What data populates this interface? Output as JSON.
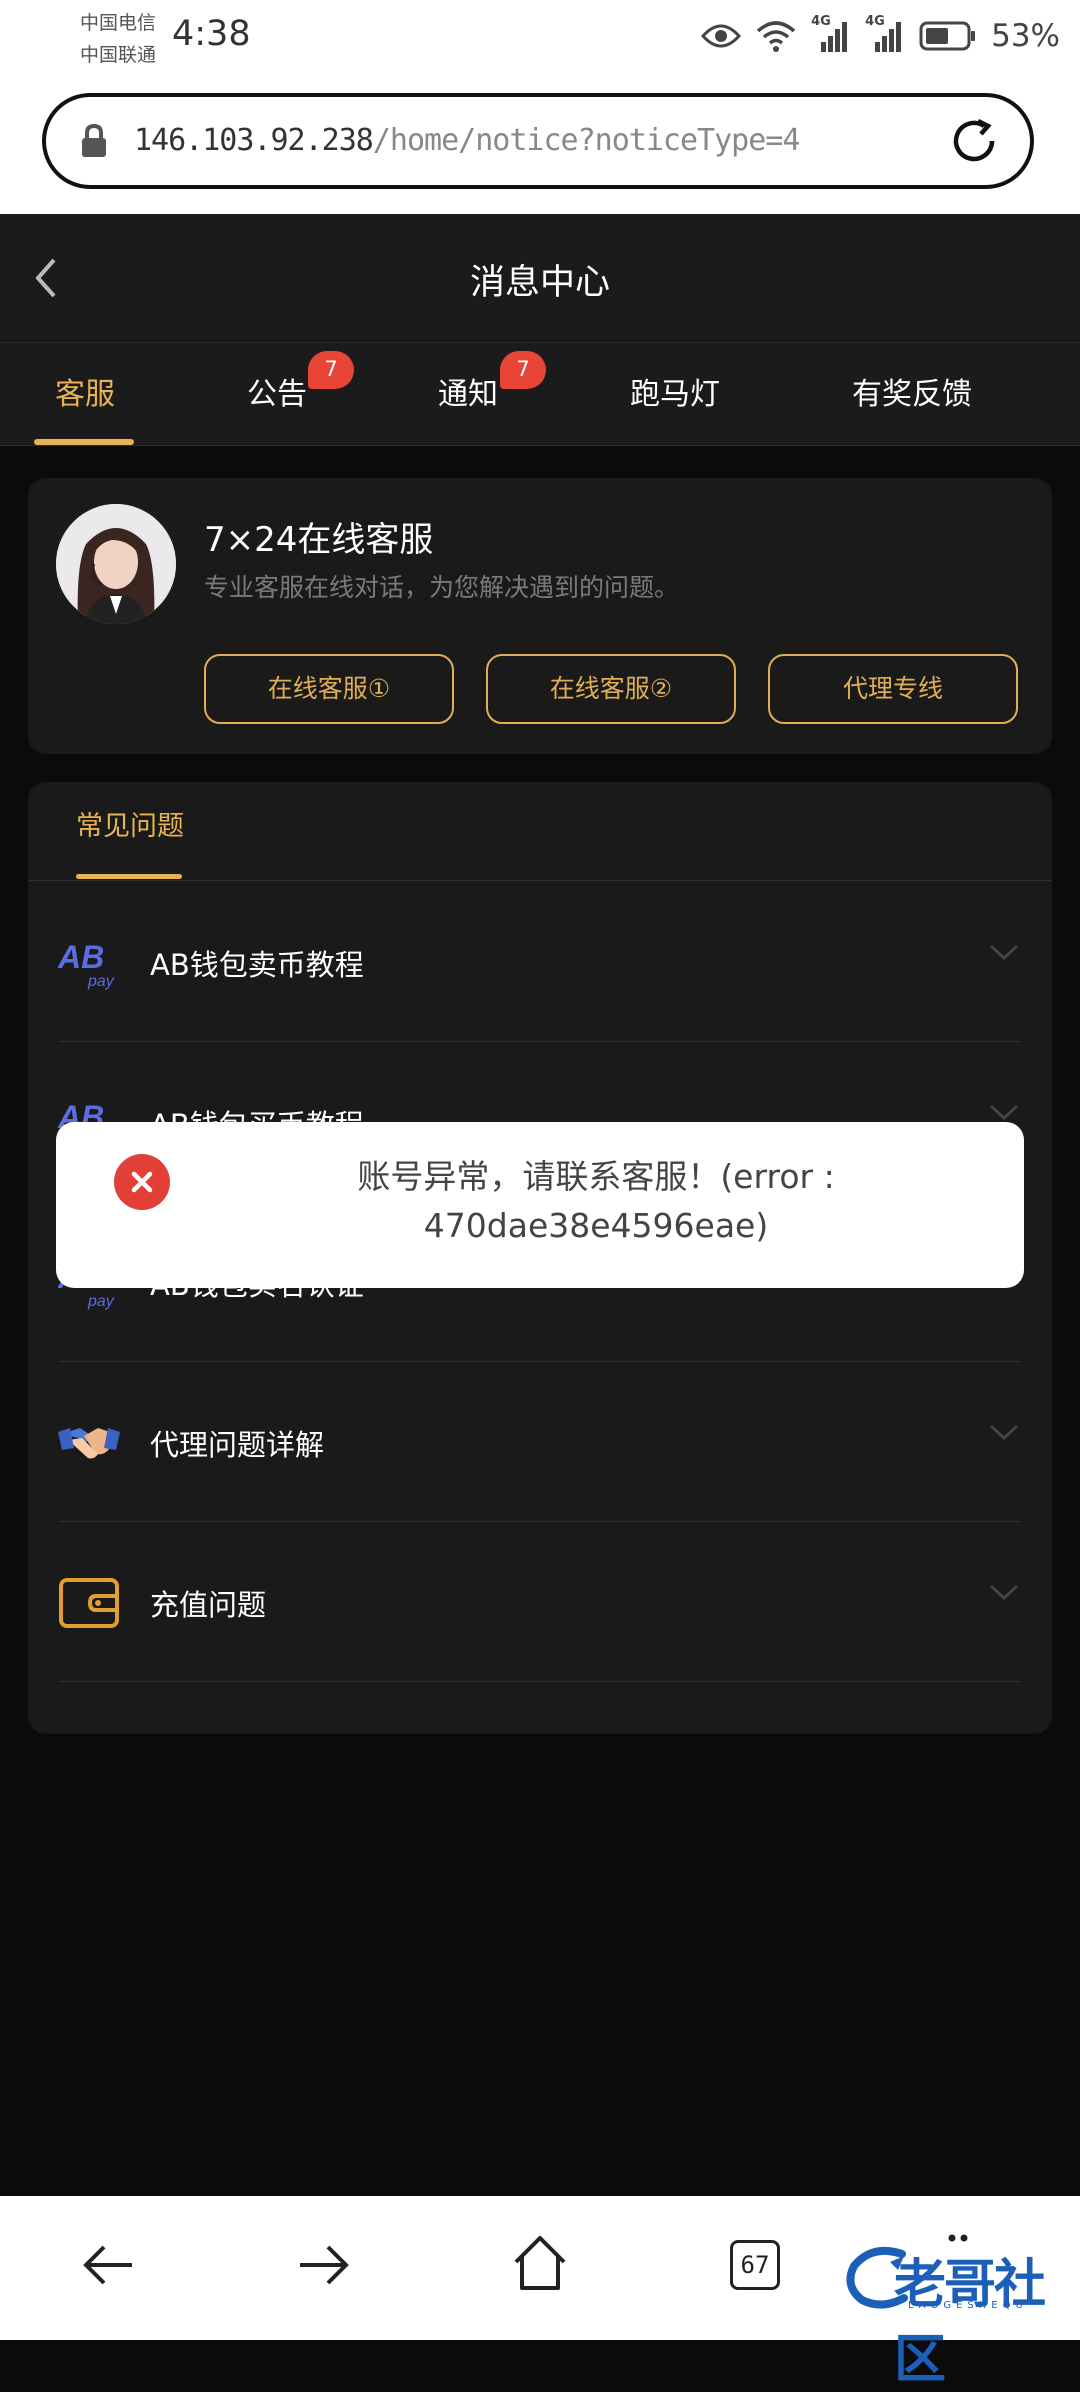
{
  "status_bar": {
    "carrier_1": "中国电信",
    "carrier_2": "中国联通",
    "time": "4:38",
    "battery": "53%",
    "network_1": "4G",
    "network_2": "4G",
    "icons": [
      "eye-icon",
      "wifi-icon",
      "signal-icon",
      "signal-icon",
      "battery-icon"
    ]
  },
  "browser": {
    "url_host": "146.103.92.238",
    "url_path": "/home/notice?noticeType=4"
  },
  "header": {
    "title": "消息中心"
  },
  "tabs": [
    {
      "label": "客服",
      "active": true
    },
    {
      "label": "公告",
      "badge": "7"
    },
    {
      "label": "通知",
      "badge": "7"
    },
    {
      "label": "跑马灯"
    },
    {
      "label": "有奖反馈"
    }
  ],
  "service": {
    "title": "7×24在线客服",
    "description": "专业客服在线对话，为您解决遇到的问题。",
    "buttons": [
      "在线客服①",
      "在线客服②",
      "代理专线"
    ]
  },
  "faq": {
    "tab_label": "常见问题",
    "items": [
      {
        "label": "AB钱包卖币教程",
        "icon": "abpay-icon"
      },
      {
        "label": "AB钱包买币教程",
        "icon": "abpay-icon"
      },
      {
        "label": "AB钱包实名认证",
        "icon": "abpay-icon"
      },
      {
        "label": "代理问题详解",
        "icon": "handshake-icon"
      },
      {
        "label": "充值问题",
        "icon": "wallet-icon"
      }
    ]
  },
  "toast": {
    "line_1": "账号异常，请联系客服！(error :",
    "line_2": "470dae38e4596eae)"
  },
  "bottom_nav": {
    "tab_count": "67",
    "watermark": "老哥社区",
    "watermark_sub": "LAOGESHEQU"
  },
  "colors": {
    "accent": "#e7b451",
    "badge": "#e84538",
    "error": "#e24036",
    "card_bg": "#1a1a1a",
    "page_bg": "#0b0b0b"
  }
}
